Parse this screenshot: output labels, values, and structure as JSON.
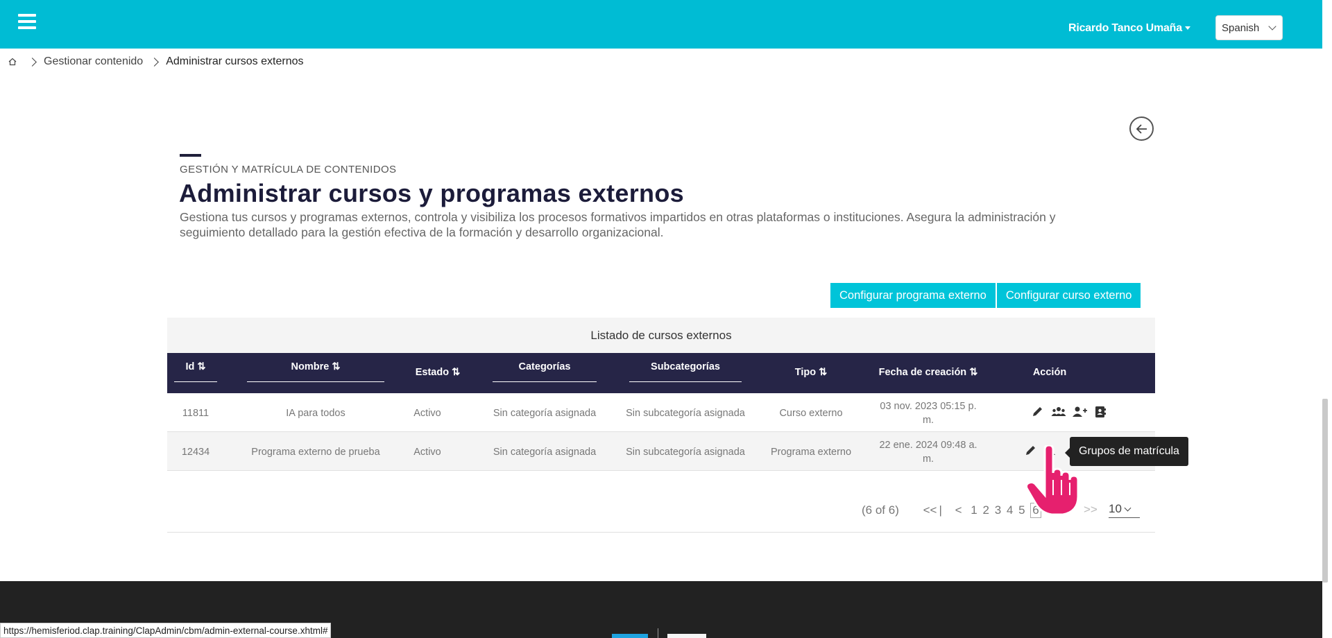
{
  "header": {
    "user_name": "Ricardo Tanco Umaña",
    "language": "Spanish"
  },
  "breadcrumb": {
    "items": [
      "Gestionar contenido",
      "Administrar cursos externos"
    ]
  },
  "page": {
    "kicker": "GESTIÓN Y MATRÍCULA DE CONTENIDOS",
    "title": "Administrar cursos y programas externos",
    "description": "Gestiona tus cursos y programas externos, controla y visibiliza los procesos formativos impartidos en otras plataformas o instituciones. Asegura la administración y seguimiento detallado para la gestión efectiva de la formación y desarrollo organizacional."
  },
  "actions": {
    "config_program": "Configurar programa externo",
    "config_course": "Configurar curso externo"
  },
  "table": {
    "caption": "Listado de cursos externos",
    "headers": {
      "id": "Id ⇅",
      "name": "Nombre  ⇅",
      "status": "Estado ⇅",
      "category": "Categorías",
      "subcategory": "Subcategorías",
      "type": "Tipo ⇅",
      "created": "Fecha de creación ⇅",
      "action": "Acción"
    },
    "rows": [
      {
        "id": "11811",
        "name": "IA para todos",
        "status": "Activo",
        "category": "Sin categoría asignada",
        "subcategory": "Sin subcategoría asignada",
        "type": "Curso externo",
        "created": "03 nov. 2023 05:15 p. m."
      },
      {
        "id": "12434",
        "name": "Programa externo de prueba",
        "status": "Activo",
        "category": "Sin categoría asignada",
        "subcategory": "Sin subcategoría asignada",
        "type": "Programa externo",
        "created": "22 ene. 2024 09:48 a. m."
      }
    ]
  },
  "pagination": {
    "summary": "(6 of 6)",
    "first": "<<",
    "prev": "<",
    "pages": [
      "1",
      "2",
      "3",
      "4",
      "5",
      "6"
    ],
    "current_page": "6",
    "next": ">",
    "last": ">>",
    "rows_per_page": "10"
  },
  "tooltip": "Grupos de matrícula",
  "status_bar": "https://hemisferiod.clap.training/ClapAdmin/cbm/admin-external-course.xhtml#",
  "colors": {
    "topbar": "#00bcd4",
    "table_header": "#262547",
    "button": "#00c4d9",
    "footer": "#222222"
  }
}
